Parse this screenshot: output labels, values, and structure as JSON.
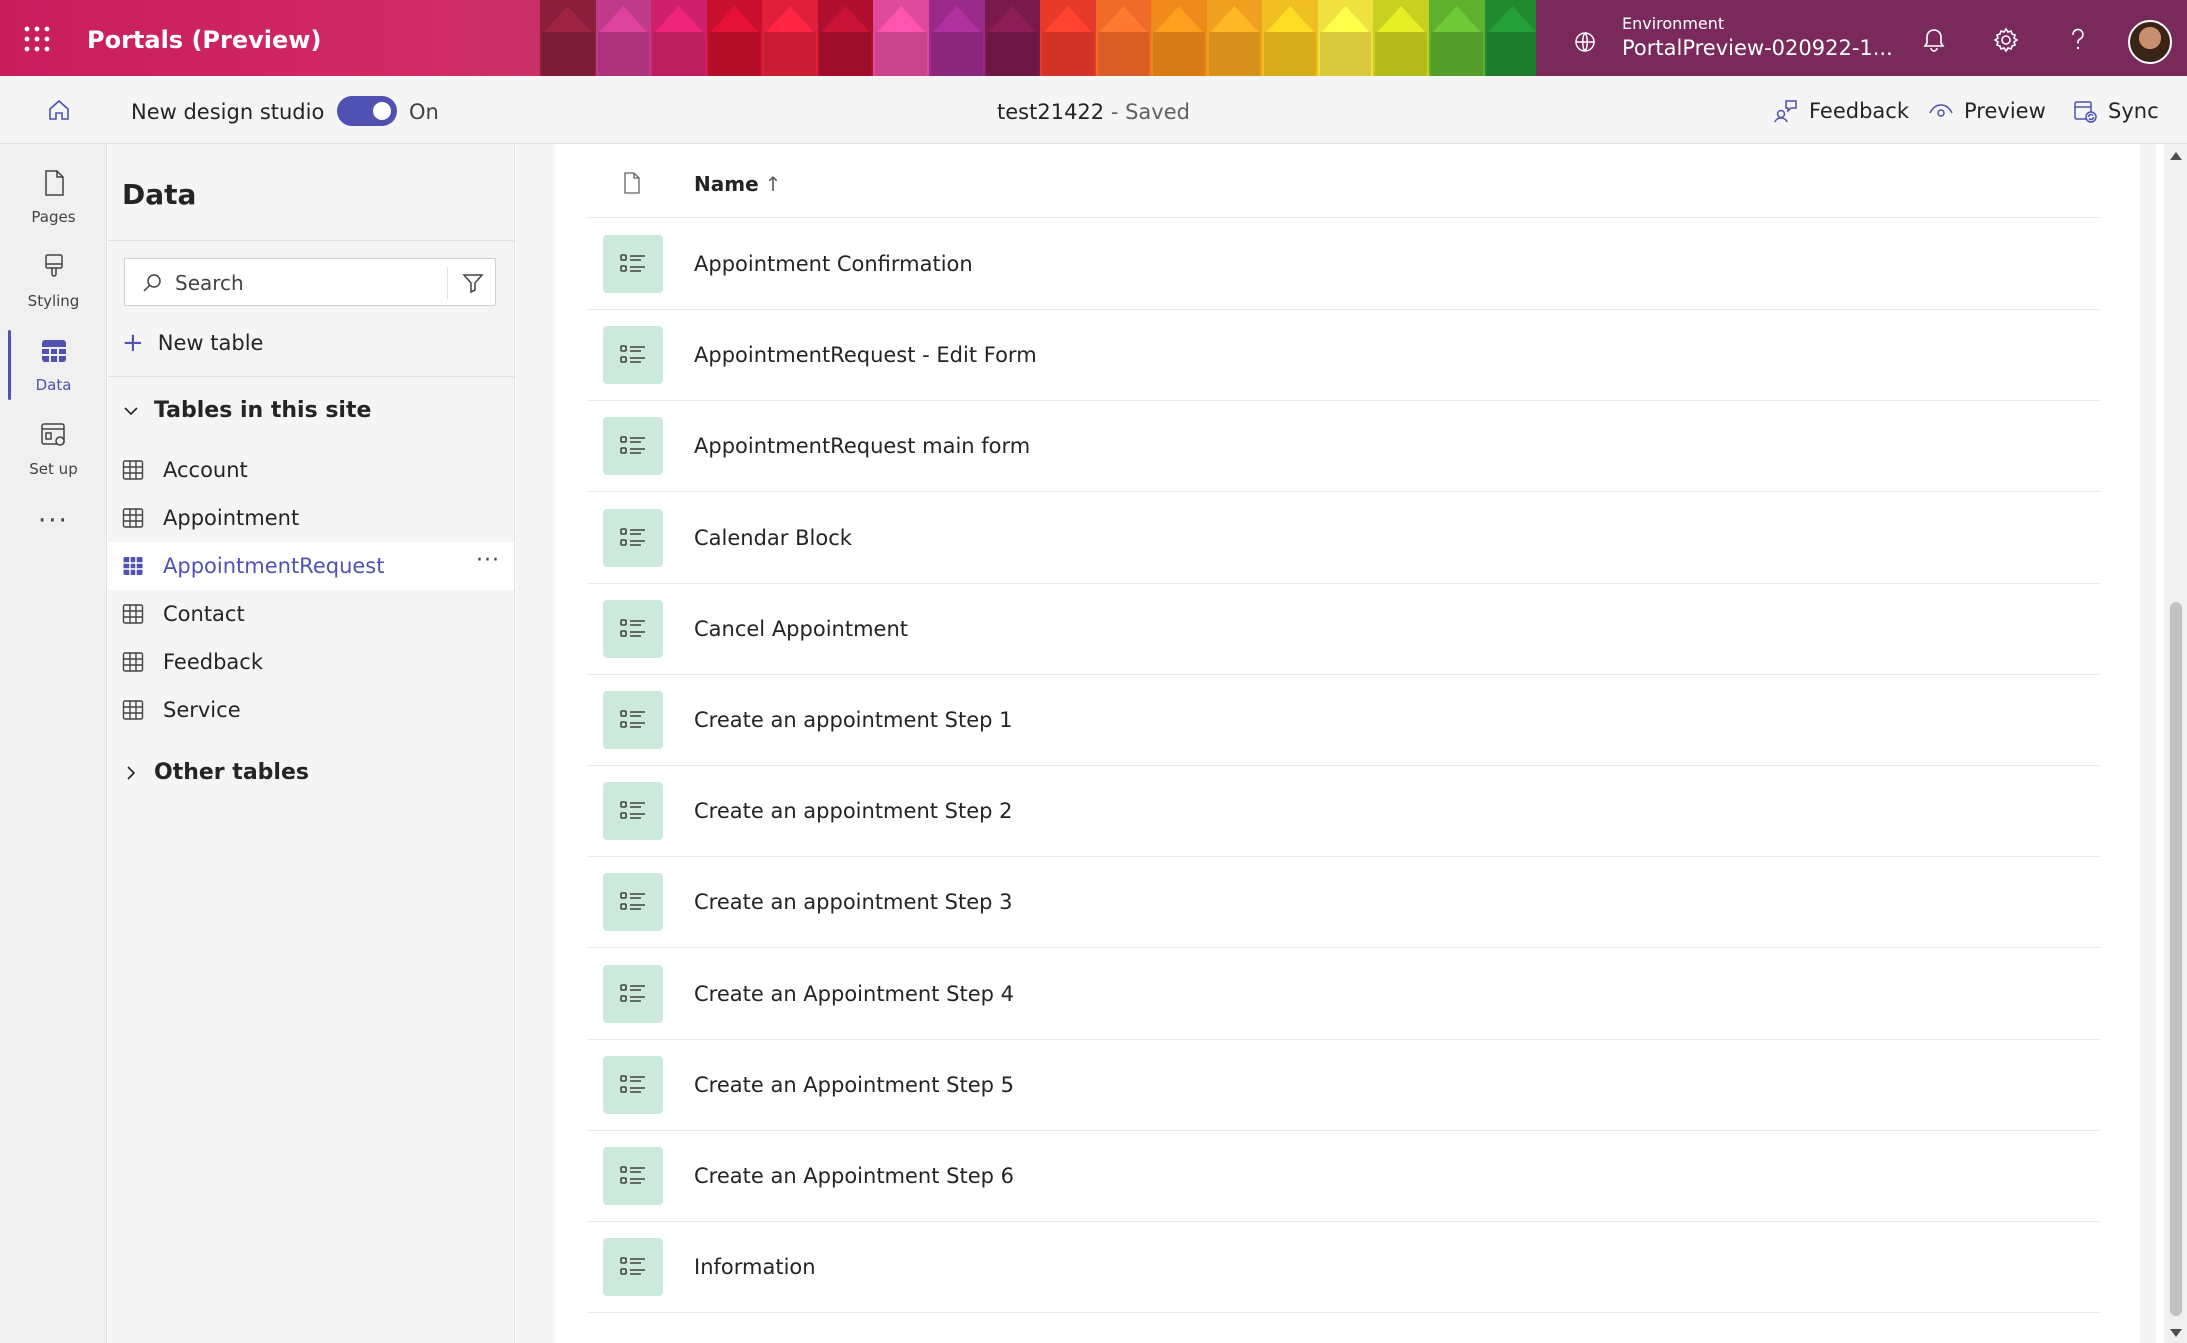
{
  "app": {
    "title": "Portals (Preview)"
  },
  "environment": {
    "label": "Environment",
    "value": "PortalPreview-020922-1..."
  },
  "commandbar": {
    "new_design_label": "New design studio",
    "toggle_state": "On",
    "site_name": "test21422",
    "site_status": " - Saved",
    "feedback_label": "Feedback",
    "preview_label": "Preview",
    "sync_label": "Sync"
  },
  "rail": {
    "pages": "Pages",
    "styling": "Styling",
    "data": "Data",
    "setup": "Set up",
    "more": "···"
  },
  "panel": {
    "title": "Data",
    "search_placeholder": "Search",
    "new_table": "New table",
    "tables_section": "Tables in this site",
    "other_section": "Other tables",
    "tables": [
      "Account",
      "Appointment",
      "AppointmentRequest",
      "Contact",
      "Feedback",
      "Service"
    ],
    "selected_table": "AppointmentRequest",
    "item_more": "···"
  },
  "list": {
    "column_name": "Name",
    "sort_indicator": "↑",
    "rows": [
      "Appointment Confirmation",
      "AppointmentRequest - Edit Form",
      "AppointmentRequest main form",
      "Calendar Block",
      "Cancel Appointment",
      "Create an appointment Step 1",
      "Create an appointment Step 2",
      "Create an appointment Step 3",
      "Create an Appointment Step 4",
      "Create an Appointment Step 5",
      "Create an Appointment Step 6",
      "Information"
    ]
  },
  "colors": {
    "accent": "#4f52b2",
    "banner": "#c81d5c",
    "form_icon_bg": "#cde9dc"
  }
}
